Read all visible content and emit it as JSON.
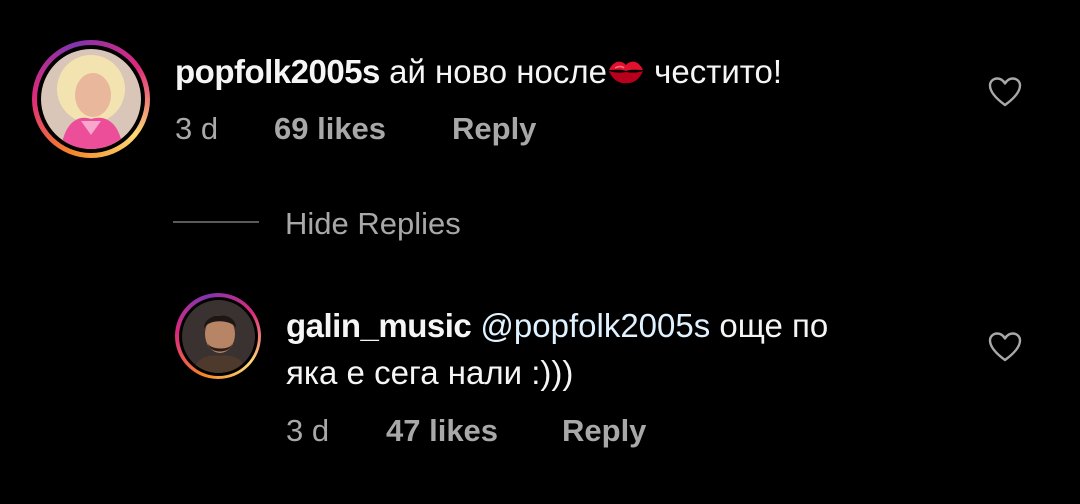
{
  "comments": [
    {
      "username": "popfolk2005s",
      "text_before_emoji": "ай ново носле",
      "emoji": "kiss-mark-icon",
      "text_after_emoji": " честито!",
      "time": "3 d",
      "likes": "69 likes",
      "reply_label": "Reply"
    }
  ],
  "hide_replies_label": "Hide Replies",
  "replies": [
    {
      "username": "galin_music",
      "mention": "@popfolk2005s",
      "text_line1": "още по",
      "text_line2": "яка е сега нали :)))",
      "time": "3 d",
      "likes": "47 likes",
      "reply_label": "Reply"
    }
  ],
  "colors": {
    "background": "#000000",
    "primary_text": "#f5f5f5",
    "secondary_text": "#a8a8a8",
    "mention": "#e0f1ff",
    "story_ring_start": "#f58529",
    "story_ring_end": "#dd2a7b"
  }
}
